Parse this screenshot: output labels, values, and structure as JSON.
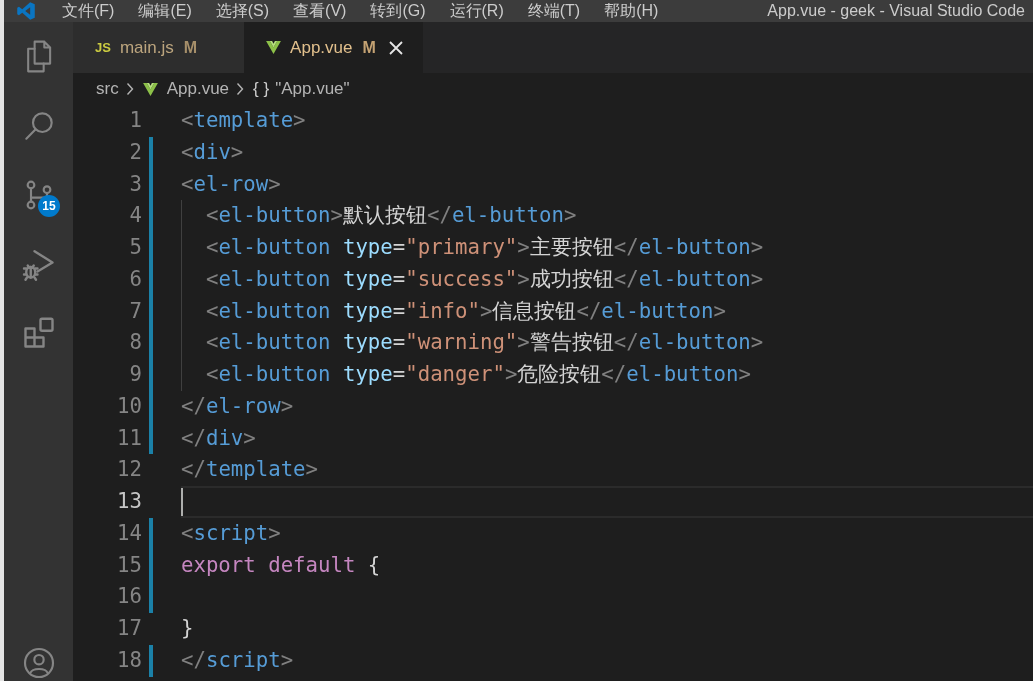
{
  "title_bar": {
    "menu": [
      "文件(F)",
      "编辑(E)",
      "选择(S)",
      "查看(V)",
      "转到(G)",
      "运行(R)",
      "终端(T)",
      "帮助(H)"
    ],
    "title": "App.vue - geek - Visual Studio Code"
  },
  "activity_bar": {
    "source_control_badge": "15"
  },
  "tabs": [
    {
      "kind": "js",
      "icon_text": "JS",
      "label": "main.js",
      "status": "M",
      "selected": false
    },
    {
      "kind": "vue",
      "label": "App.vue",
      "status": "M",
      "selected": true
    }
  ],
  "breadcrumb": [
    {
      "kind": "folder",
      "label": "src"
    },
    {
      "kind": "vue",
      "label": "App.vue"
    },
    {
      "kind": "symbol",
      "icon_text": "{ }",
      "label": "\"App.vue\""
    }
  ],
  "editor": {
    "lines": [
      {
        "number": "1",
        "modified": false,
        "indented": false,
        "current": false,
        "tokens": [
          {
            "kind": "bracket",
            "text": "<"
          },
          {
            "kind": "tag",
            "text": "template"
          },
          {
            "kind": "bracket",
            "text": ">"
          }
        ]
      },
      {
        "number": "2",
        "modified": true,
        "indented": false,
        "current": false,
        "tokens": [
          {
            "kind": "bracket",
            "text": "<"
          },
          {
            "kind": "tag",
            "text": "div"
          },
          {
            "kind": "bracket",
            "text": ">"
          }
        ]
      },
      {
        "number": "3",
        "modified": true,
        "indented": false,
        "current": false,
        "tokens": [
          {
            "kind": "bracket",
            "text": "<"
          },
          {
            "kind": "tag",
            "text": "el-row"
          },
          {
            "kind": "bracket",
            "text": ">"
          }
        ]
      },
      {
        "number": "4",
        "modified": true,
        "indented": true,
        "current": false,
        "tokens": [
          {
            "kind": "bracket",
            "text": "<"
          },
          {
            "kind": "tag",
            "text": "el-button"
          },
          {
            "kind": "bracket",
            "text": ">"
          },
          {
            "kind": "text",
            "text": "默认按钮"
          },
          {
            "kind": "bracket",
            "text": "</"
          },
          {
            "kind": "tag",
            "text": "el-button"
          },
          {
            "kind": "bracket",
            "text": ">"
          }
        ]
      },
      {
        "number": "5",
        "modified": true,
        "indented": true,
        "current": false,
        "tokens": [
          {
            "kind": "bracket",
            "text": "<"
          },
          {
            "kind": "tag",
            "text": "el-button"
          },
          {
            "kind": "attr",
            "text": " type"
          },
          {
            "kind": "op",
            "text": "="
          },
          {
            "kind": "string",
            "text": "\"primary\""
          },
          {
            "kind": "bracket",
            "text": ">"
          },
          {
            "kind": "text",
            "text": "主要按钮"
          },
          {
            "kind": "bracket",
            "text": "</"
          },
          {
            "kind": "tag",
            "text": "el-button"
          },
          {
            "kind": "bracket",
            "text": ">"
          }
        ]
      },
      {
        "number": "6",
        "modified": true,
        "indented": true,
        "current": false,
        "tokens": [
          {
            "kind": "bracket",
            "text": "<"
          },
          {
            "kind": "tag",
            "text": "el-button"
          },
          {
            "kind": "attr",
            "text": " type"
          },
          {
            "kind": "op",
            "text": "="
          },
          {
            "kind": "string",
            "text": "\"success\""
          },
          {
            "kind": "bracket",
            "text": ">"
          },
          {
            "kind": "text",
            "text": "成功按钮"
          },
          {
            "kind": "bracket",
            "text": "</"
          },
          {
            "kind": "tag",
            "text": "el-button"
          },
          {
            "kind": "bracket",
            "text": ">"
          }
        ]
      },
      {
        "number": "7",
        "modified": true,
        "indented": true,
        "current": false,
        "tokens": [
          {
            "kind": "bracket",
            "text": "<"
          },
          {
            "kind": "tag",
            "text": "el-button"
          },
          {
            "kind": "attr",
            "text": " type"
          },
          {
            "kind": "op",
            "text": "="
          },
          {
            "kind": "string",
            "text": "\"info\""
          },
          {
            "kind": "bracket",
            "text": ">"
          },
          {
            "kind": "text",
            "text": "信息按钮"
          },
          {
            "kind": "bracket",
            "text": "</"
          },
          {
            "kind": "tag",
            "text": "el-button"
          },
          {
            "kind": "bracket",
            "text": ">"
          }
        ]
      },
      {
        "number": "8",
        "modified": true,
        "indented": true,
        "current": false,
        "tokens": [
          {
            "kind": "bracket",
            "text": "<"
          },
          {
            "kind": "tag",
            "text": "el-button"
          },
          {
            "kind": "attr",
            "text": " type"
          },
          {
            "kind": "op",
            "text": "="
          },
          {
            "kind": "string",
            "text": "\"warning\""
          },
          {
            "kind": "bracket",
            "text": ">"
          },
          {
            "kind": "text",
            "text": "警告按钮"
          },
          {
            "kind": "bracket",
            "text": "</"
          },
          {
            "kind": "tag",
            "text": "el-button"
          },
          {
            "kind": "bracket",
            "text": ">"
          }
        ]
      },
      {
        "number": "9",
        "modified": true,
        "indented": true,
        "current": false,
        "tokens": [
          {
            "kind": "bracket",
            "text": "<"
          },
          {
            "kind": "tag",
            "text": "el-button"
          },
          {
            "kind": "attr",
            "text": " type"
          },
          {
            "kind": "op",
            "text": "="
          },
          {
            "kind": "string",
            "text": "\"danger\""
          },
          {
            "kind": "bracket",
            "text": ">"
          },
          {
            "kind": "text",
            "text": "危险按钮"
          },
          {
            "kind": "bracket",
            "text": "</"
          },
          {
            "kind": "tag",
            "text": "el-button"
          },
          {
            "kind": "bracket",
            "text": ">"
          }
        ]
      },
      {
        "number": "10",
        "modified": true,
        "indented": false,
        "current": false,
        "tokens": [
          {
            "kind": "bracket",
            "text": "</"
          },
          {
            "kind": "tag",
            "text": "el-row"
          },
          {
            "kind": "bracket",
            "text": ">"
          }
        ]
      },
      {
        "number": "11",
        "modified": true,
        "indented": false,
        "current": false,
        "tokens": [
          {
            "kind": "bracket",
            "text": "</"
          },
          {
            "kind": "tag",
            "text": "div"
          },
          {
            "kind": "bracket",
            "text": ">"
          }
        ]
      },
      {
        "number": "12",
        "modified": false,
        "indented": false,
        "current": false,
        "tokens": [
          {
            "kind": "bracket",
            "text": "</"
          },
          {
            "kind": "tag",
            "text": "template"
          },
          {
            "kind": "bracket",
            "text": ">"
          }
        ]
      },
      {
        "number": "13",
        "modified": false,
        "indented": false,
        "current": true
      },
      {
        "number": "14",
        "modified": true,
        "indented": false,
        "current": false,
        "tokens": [
          {
            "kind": "bracket",
            "text": "<"
          },
          {
            "kind": "tag",
            "text": "script"
          },
          {
            "kind": "bracket",
            "text": ">"
          }
        ]
      },
      {
        "number": "15",
        "modified": true,
        "indented": false,
        "current": false,
        "tokens": [
          {
            "kind": "keyword",
            "text": "export"
          },
          {
            "kind": "keyword",
            "text": " default"
          },
          {
            "kind": "text",
            "text": " {"
          }
        ]
      },
      {
        "number": "16",
        "modified": true,
        "indented": false,
        "current": false
      },
      {
        "number": "17",
        "modified": false,
        "indented": false,
        "current": false,
        "tokens": [
          {
            "kind": "text",
            "text": "}"
          }
        ]
      },
      {
        "number": "18",
        "modified": true,
        "indented": false,
        "current": false,
        "tokens": [
          {
            "kind": "bracket",
            "text": "</"
          },
          {
            "kind": "tag",
            "text": "script"
          },
          {
            "kind": "bracket",
            "text": ">"
          }
        ]
      }
    ]
  }
}
